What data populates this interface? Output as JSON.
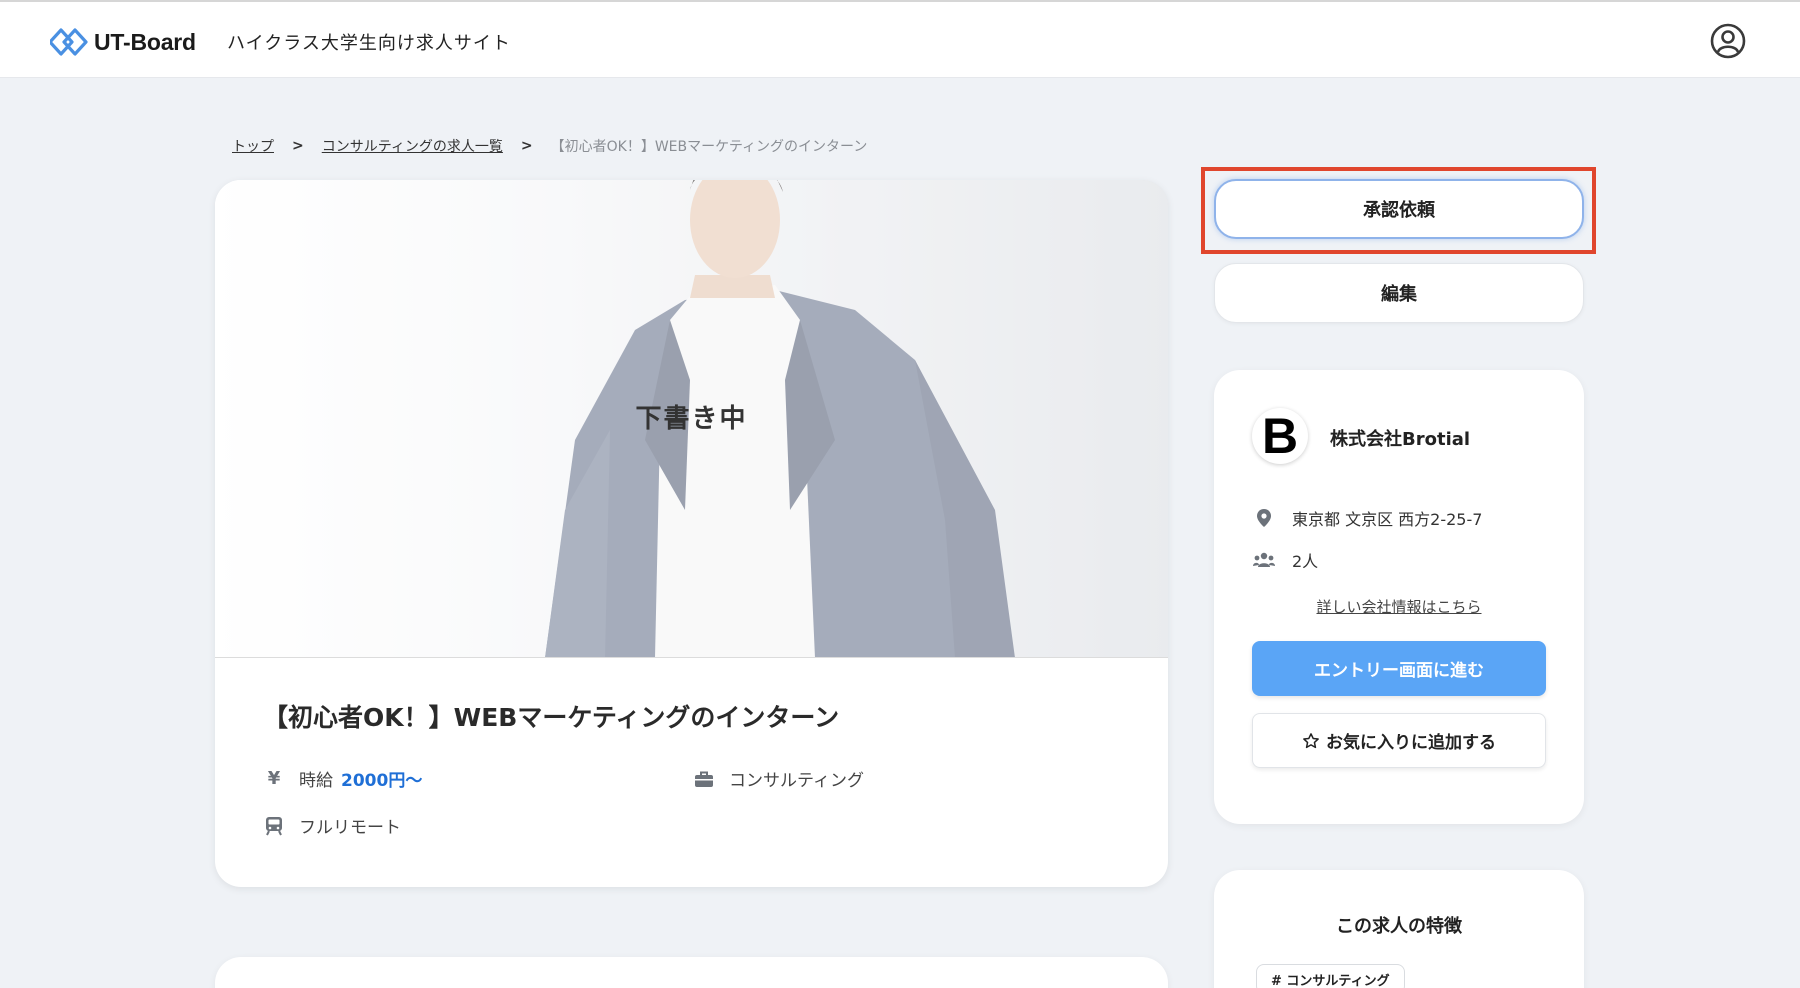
{
  "header": {
    "logo_text": "UT-Board",
    "tagline": "ハイクラス大学生向け求人サイト",
    "user_icon": "user-circle-icon"
  },
  "breadcrumb": {
    "items": [
      "トップ",
      "コンサルティングの求人一覧"
    ],
    "separator": ">",
    "current": "【初心者OK！】WEBマーケティングのインターン"
  },
  "job": {
    "status_overlay": "下書き中",
    "title": "【初心者OK！】WEBマーケティングのインターン",
    "wage_icon": "¥",
    "wage_label": "時給",
    "wage_value": "2000円〜",
    "category_icon": "briefcase-icon",
    "category": "コンサルティング",
    "work_style_icon": "train-icon",
    "work_style": "フルリモート"
  },
  "actions": {
    "approve_label": "承認依頼",
    "edit_label": "編集"
  },
  "company": {
    "logo_letter": "B",
    "name": "株式会社Brotial",
    "address_icon": "map-pin-icon",
    "address": "東京都 文京区 西方2-25-7",
    "employees_icon": "users-icon",
    "employees": "2人",
    "detail_link": "詳しい会社情報はこちら",
    "entry_button": "エントリー画面に進む",
    "favorite_button": "お気に入りに追加する",
    "favorite_icon": "star-outline-icon"
  },
  "features": {
    "title": "この求人の特徴",
    "tags": [
      "# コンサルティング"
    ]
  },
  "colors": {
    "accent_blue": "#5aa5f6",
    "wage_blue": "#1f6fd6",
    "highlight_red": "#e0462d",
    "page_bg": "#eff2f6"
  }
}
